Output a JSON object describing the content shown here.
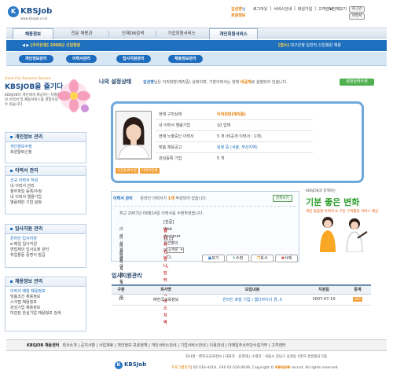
{
  "header": {
    "logo_mark": "K",
    "logo_text": "KBSJob",
    "logo_url": "www.kbsjob.co.kr",
    "greet_user": "김선영",
    "greet_suffix": "님",
    "greet_link": "회원정보",
    "links": [
      "로그아웃",
      "서비스안내",
      "회원가입",
      "고객센터"
    ],
    "util_label": "전체보기",
    "util_btn1": "로그인",
    "util_btn2": "이력서"
  },
  "nav": {
    "tabs": [
      "채용정보",
      "전문 채용관",
      "인재DB검색",
      "기업회원서비스",
      "개인회원서비스"
    ]
  },
  "news": {
    "left": "[우리은행] 2008년 신입행원",
    "right_tag": "[접수]",
    "right": "대구은행 일반직 신입행원 채용"
  },
  "subnav": {
    "items": [
      "개인정보관리",
      "이력서관리",
      "입사지원관리",
      "채용정보관리"
    ]
  },
  "sidebar": {
    "tagline": "Have Fun Resume Service",
    "brand": "KBSJOB을 즐기다",
    "desc": "KBSJOB이 개인에게 제공하는 차별화된 이력서 및 채용서비스를 경험하실 수 있습니다.",
    "sections": [
      {
        "title": "개인정보 관리",
        "items": [
          "개인정보수정",
          "회원탈퇴신청"
        ]
      },
      {
        "title": "이력서 관리",
        "items": [
          "신규 이력서 작성",
          "내 이력서 관리",
          "첨부파일 등록/수정",
          "내 이력서 열람기업",
          "열람제한 기업 설정"
        ]
      },
      {
        "title": "입사지원 관리",
        "items": [
          "온라인 입사지원",
          "e-메일 입사지원",
          "면접제의 입사요청 관리",
          "취업활동 증명서 발급"
        ]
      },
      {
        "title": "채용정보 관리",
        "items": [
          "이력서 매칭 채용정보",
          "맞춤조건 채용정보",
          "스크랩 채용정보",
          "관심기업 채용정보",
          "마감된 관심기업 채용정보 검색"
        ]
      }
    ]
  },
  "main": {
    "title": "나의 설정상태",
    "desc_name": "김선영",
    "desc_mid": "님은 이직희망(재직중) 상태이며, 기본이력서는 현재 ",
    "desc_hl": "비공개",
    "desc_end": "로 설정되어 있습니다.",
    "settings_btn": "설정상태수정",
    "photo_btn1": "사진등록수정",
    "photo_btn2": "이력서인쇄",
    "rows": [
      {
        "k": "현재 구직상태",
        "v": "이직희망(재직중)",
        "style": "orange"
      },
      {
        "k": "내 이력서 열람기업",
        "v": "10 업체",
        "style": "normal"
      },
      {
        "k": "현재 노출중인 이력서",
        "v": "5 개 (비공개 이력서 : 1개)",
        "style": "normal"
      },
      {
        "k": "맞춤 채용공고",
        "v": "설정 중 (서울, 부산지역)",
        "style": "blue"
      },
      {
        "k": "관심등록 기업",
        "v": "5 개",
        "style": "normal"
      }
    ]
  },
  "resume": {
    "label": "이력서 관리",
    "text_pre": "온라인 이력서가 ",
    "count": "1개",
    "text_post": " 작성되어 있습니다.",
    "all_btn": "전체보기",
    "date": "최근 2007년 09월14일 이력서를 수정하셨습니다.",
    "rows": [
      {
        "k": "· 이력서 제목",
        "v": "[한글] Web designer 김선영의 이력서입니다.",
        "style": "normal"
      },
      {
        "k": "· 이력서 태그",
        "v": "웹디자인,경나,인터넷레이스 지역",
        "style": "red"
      },
      {
        "k": "· 이력서 열람횟수",
        "v": "1111",
        "style": "normal"
      },
      {
        "k": "· 이력서 공개여부",
        "v": "",
        "style": "normal"
      }
    ],
    "select_value": "공개중",
    "actions": [
      "보기",
      "수정",
      "복사",
      "삭제"
    ]
  },
  "ad": {
    "top": "KBSJOB과 함께하는",
    "big": "기분 좋은 변화",
    "sub": "개인 맞춤형 이력서 & 구인 구직활동 서비스 제공"
  },
  "apply": {
    "title": "입사지원관리",
    "columns": [
      "구분",
      "회사명",
      "모집내용",
      "지원일",
      "통계"
    ],
    "rows": [
      {
        "no": "10",
        "company": "㈜한국교육정보",
        "content": "온라인 포털 기업 / 웹디자이너 경..5",
        "date": "2007-07-10",
        "stat": "보기"
      }
    ]
  },
  "footer": {
    "brand": "KBSJOB 채용센터",
    "links": "회사소개 | 공지사항 | 사업제휴 | 개인정보 보호정책 | 개인서비스안내 | 기업서비스안내 | 이용안내 | 이메일주소무단수집거부 | 고객센터",
    "addr": "회사명 : ㈜한국교육정보 | 대표자 : 윤영재 | 소재지 : 서울시 강남구 삼성동 5번지 성일빌딩 5층",
    "tel_label": "프로그램관리",
    "copy": "| 02-516-4419 , FAX 02-516-0039,  Copyright © ",
    "copy_brand": "KBSJOB",
    "copy_end": " recruit.  All rights reserved."
  },
  "colors": {
    "brand_blue": "#1d6bbd",
    "accent_orange": "#e57a00",
    "green": "#4fb04f"
  }
}
